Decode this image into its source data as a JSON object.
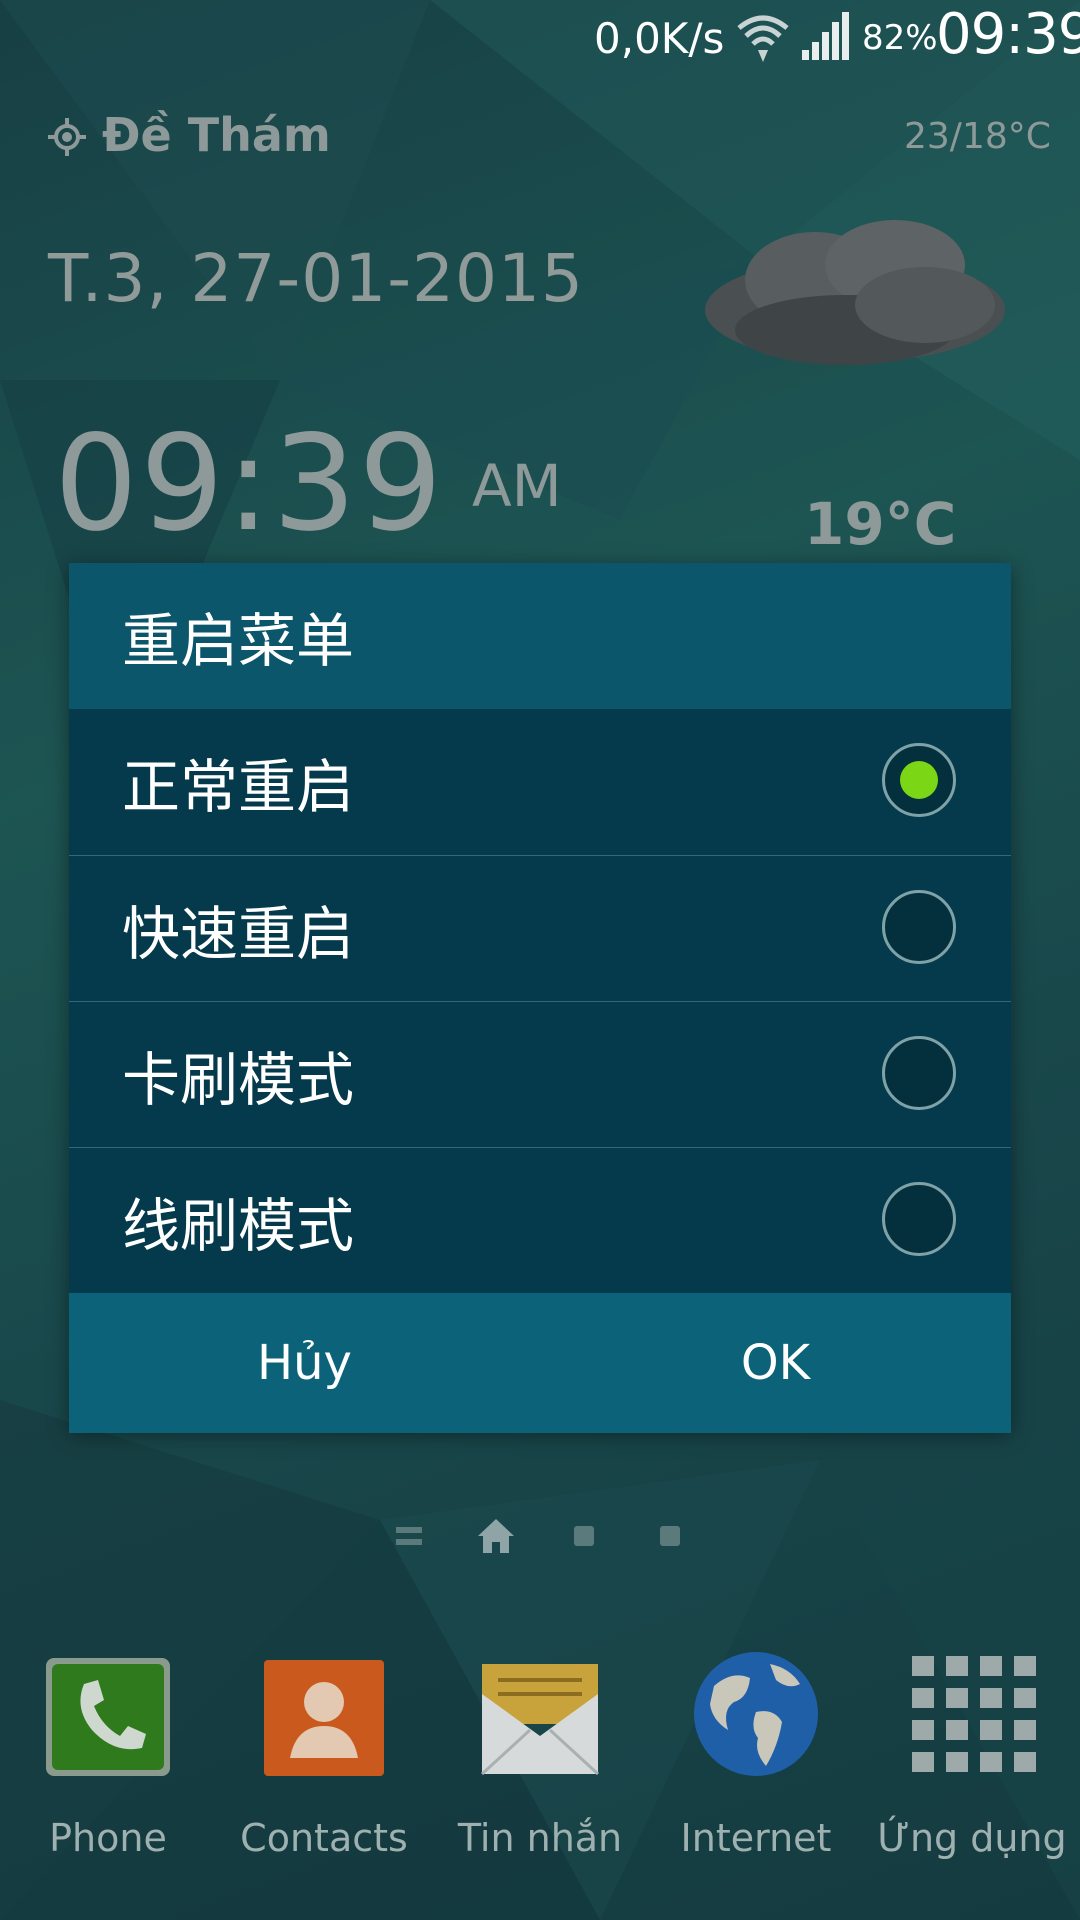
{
  "status_bar": {
    "net_speed": "0,0K/s",
    "battery": "82%",
    "clock": "09:39"
  },
  "weather": {
    "location": "Đề Thám",
    "temp_range": "23/18°C",
    "date": "T.3, 27-01-2015",
    "time": "09:39",
    "ampm": "AM",
    "temp_now": "19°C"
  },
  "dialog": {
    "title": "重启菜单",
    "options": [
      {
        "label": "正常重启",
        "selected": true
      },
      {
        "label": "快速重启",
        "selected": false
      },
      {
        "label": "卡刷模式",
        "selected": false
      },
      {
        "label": "线刷模式",
        "selected": false
      }
    ],
    "cancel_label": "Hủy",
    "ok_label": "OK",
    "accent": "#7bd616"
  },
  "dock": {
    "items": [
      {
        "label": "Phone",
        "icon": "phone-icon"
      },
      {
        "label": "Contacts",
        "icon": "contacts-icon"
      },
      {
        "label": "Tin nhắn",
        "icon": "messages-icon"
      },
      {
        "label": "Internet",
        "icon": "globe-icon"
      },
      {
        "label": "Ứng dụng",
        "icon": "apps-grid-icon"
      }
    ]
  }
}
